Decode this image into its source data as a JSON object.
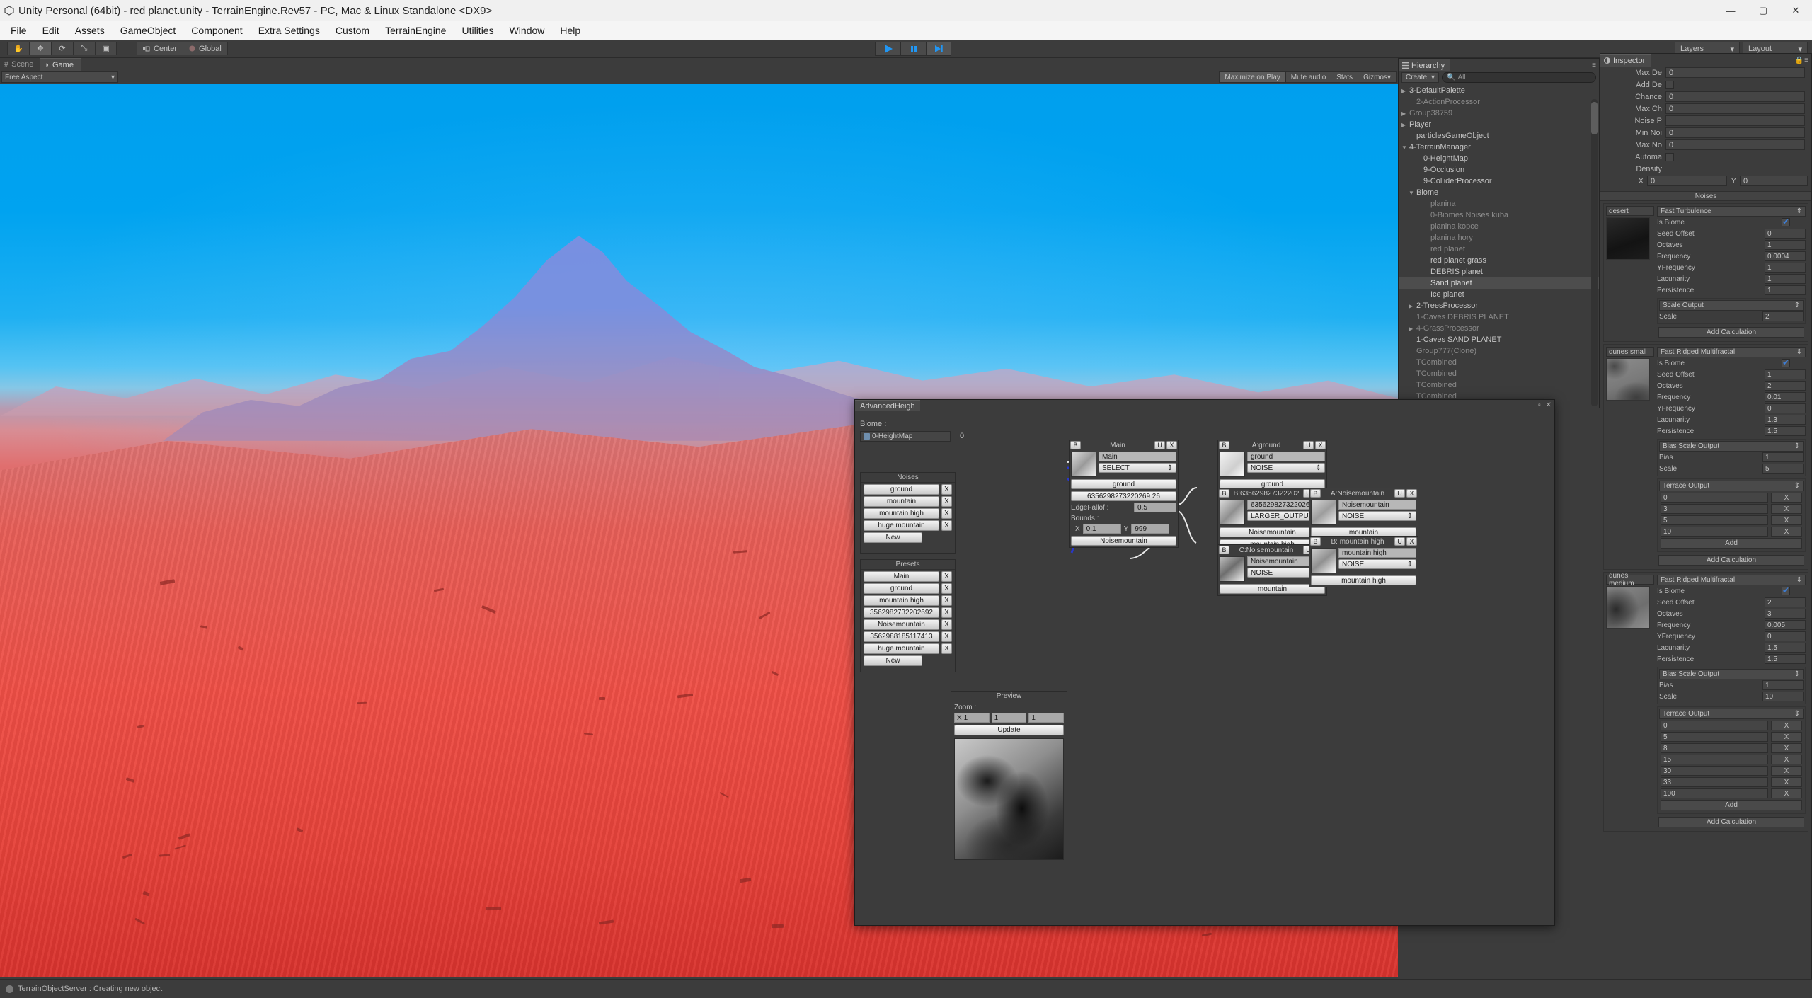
{
  "window": {
    "title": "Unity Personal (64bit) - red planet.unity - TerrainEngine.Rev57 - PC, Mac & Linux Standalone <DX9>",
    "app_icon": "unity-icon",
    "minimize": "—",
    "maximize": "▢",
    "close": "✕"
  },
  "menubar": {
    "items": [
      "File",
      "Edit",
      "Assets",
      "GameObject",
      "Component",
      "Extra Settings",
      "Custom",
      "TerrainEngine",
      "Utilities",
      "Window",
      "Help"
    ]
  },
  "toolbar": {
    "tools": [
      {
        "name": "hand-tool",
        "glyph": "✋",
        "active": false
      },
      {
        "name": "move-tool",
        "glyph": "✥",
        "active": true
      },
      {
        "name": "rotate-tool",
        "glyph": "⟳",
        "active": false
      },
      {
        "name": "scale-tool",
        "glyph": "⤡",
        "active": false
      },
      {
        "name": "rect-tool",
        "glyph": "▣",
        "active": false
      }
    ],
    "pivot": "Center",
    "handle": "Global",
    "play": "▶",
    "pause": "❙❙",
    "step": "▶❙",
    "layers": "Layers",
    "layout": "Layout"
  },
  "gameview": {
    "tabs": [
      {
        "label": "Scene",
        "icon": "scene-icon",
        "active": false
      },
      {
        "label": "Game",
        "icon": "game-icon",
        "active": true
      }
    ],
    "aspect": "Free Aspect",
    "buttons": [
      "Maximize on Play",
      "Mute audio",
      "Stats",
      "Gizmos"
    ]
  },
  "hierarchy": {
    "title": "Hierarchy",
    "create_label": "Create",
    "search_placeholder": "All",
    "search_value": "",
    "items": [
      {
        "label": "3-DefaultPalette",
        "indent": 0,
        "arrow": "▶",
        "dim": false,
        "selected": false
      },
      {
        "label": "2-ActionProcessor",
        "indent": 1,
        "arrow": "",
        "dim": true,
        "selected": false
      },
      {
        "label": "Group38759",
        "indent": 0,
        "arrow": "▶",
        "dim": true,
        "selected": false
      },
      {
        "label": "Player",
        "indent": 0,
        "arrow": "▶",
        "dim": false,
        "selected": false
      },
      {
        "label": "particlesGameObject",
        "indent": 1,
        "arrow": "",
        "dim": false,
        "selected": false
      },
      {
        "label": "4-TerrainManager",
        "indent": 0,
        "arrow": "▼",
        "dim": false,
        "selected": false
      },
      {
        "label": "0-HeightMap",
        "indent": 2,
        "arrow": "",
        "dim": false,
        "selected": false
      },
      {
        "label": "9-Occlusion",
        "indent": 2,
        "arrow": "",
        "dim": false,
        "selected": false
      },
      {
        "label": "9-ColliderProcessor",
        "indent": 2,
        "arrow": "",
        "dim": false,
        "selected": false
      },
      {
        "label": "Biome",
        "indent": 1,
        "arrow": "▼",
        "dim": false,
        "selected": false
      },
      {
        "label": "planina",
        "indent": 3,
        "arrow": "",
        "dim": true,
        "selected": false
      },
      {
        "label": "0-Biomes Noises kuba",
        "indent": 3,
        "arrow": "",
        "dim": true,
        "selected": false
      },
      {
        "label": "planina kopce",
        "indent": 3,
        "arrow": "",
        "dim": true,
        "selected": false
      },
      {
        "label": "planina hory",
        "indent": 3,
        "arrow": "",
        "dim": true,
        "selected": false
      },
      {
        "label": "red planet",
        "indent": 3,
        "arrow": "",
        "dim": true,
        "selected": false
      },
      {
        "label": "red planet grass",
        "indent": 3,
        "arrow": "",
        "dim": false,
        "selected": false
      },
      {
        "label": "DEBRIS planet",
        "indent": 3,
        "arrow": "",
        "dim": false,
        "selected": false
      },
      {
        "label": "Sand planet",
        "indent": 3,
        "arrow": "",
        "dim": true,
        "selected": true
      },
      {
        "label": "Ice planet",
        "indent": 3,
        "arrow": "",
        "dim": false,
        "selected": false
      },
      {
        "label": "2-TreesProcessor",
        "indent": 1,
        "arrow": "▶",
        "dim": false,
        "selected": false
      },
      {
        "label": "1-Caves DEBRIS PLANET",
        "indent": 1,
        "arrow": "",
        "dim": true,
        "selected": false
      },
      {
        "label": "4-GrassProcessor",
        "indent": 1,
        "arrow": "▶",
        "dim": true,
        "selected": false
      },
      {
        "label": "1-Caves SAND PLANET",
        "indent": 1,
        "arrow": "",
        "dim": false,
        "selected": false
      },
      {
        "label": "Group777(Clone)",
        "indent": 1,
        "arrow": "",
        "dim": true,
        "selected": false
      },
      {
        "label": "TCombined",
        "indent": 1,
        "arrow": "",
        "dim": true,
        "selected": false
      },
      {
        "label": "TCombined",
        "indent": 1,
        "arrow": "",
        "dim": true,
        "selected": false
      },
      {
        "label": "TCombined",
        "indent": 1,
        "arrow": "",
        "dim": true,
        "selected": false
      },
      {
        "label": "TCombined",
        "indent": 1,
        "arrow": "",
        "dim": true,
        "selected": false
      }
    ]
  },
  "inspector": {
    "title": "Inspector",
    "top_fields": [
      {
        "label": "Max De",
        "type": "text",
        "value": "0"
      },
      {
        "label": "Add De",
        "type": "check",
        "value": false
      },
      {
        "label": "Chance",
        "type": "text",
        "value": "0"
      },
      {
        "label": "Max Ch",
        "type": "text",
        "value": "0"
      },
      {
        "label": "Noise P",
        "type": "text",
        "value": ""
      },
      {
        "label": "Min Noi",
        "type": "text",
        "value": "0"
      },
      {
        "label": "Max No",
        "type": "text",
        "value": "0"
      },
      {
        "label": "Automa",
        "type": "check",
        "value": false
      }
    ],
    "density_label": "Density",
    "density_x_label": "X",
    "density_x": "0",
    "density_y_label": "Y",
    "density_y": "0",
    "noises_header": "Noises",
    "noises": [
      {
        "name": "desert",
        "type": "Fast Turbulence",
        "props": [
          {
            "label": "Is Biome",
            "value": "",
            "checked": true
          },
          {
            "label": "Seed Offset",
            "value": "0"
          },
          {
            "label": "Octaves",
            "value": "1"
          },
          {
            "label": "Frequency",
            "value": "0.0004"
          },
          {
            "label": "YFrequency",
            "value": "1"
          },
          {
            "label": "Lacunarity",
            "value": "1"
          },
          {
            "label": "Persistence",
            "value": "1"
          }
        ],
        "calcs": [
          {
            "type": "Scale Output",
            "rows": [
              {
                "label": "Scale",
                "value": "2"
              }
            ],
            "terrace": []
          }
        ],
        "add_calc": "Add Calculation"
      },
      {
        "name": "dunes small",
        "type": "Fast Ridged Multifractal",
        "props": [
          {
            "label": "Is Biome",
            "value": "",
            "checked": true
          },
          {
            "label": "Seed Offset",
            "value": "1"
          },
          {
            "label": "Octaves",
            "value": "2"
          },
          {
            "label": "Frequency",
            "value": "0.01"
          },
          {
            "label": "YFrequency",
            "value": "0"
          },
          {
            "label": "Lacunarity",
            "value": "1.3"
          },
          {
            "label": "Persistence",
            "value": "1.5"
          }
        ],
        "calcs": [
          {
            "type": "Bias Scale Output",
            "rows": [
              {
                "label": "Bias",
                "value": "1"
              },
              {
                "label": "Scale",
                "value": "5"
              }
            ],
            "terrace": []
          },
          {
            "type": "Terrace Output",
            "rows": [],
            "terrace": [
              "0",
              "3",
              "5",
              "10"
            ],
            "add_label": "Add"
          }
        ],
        "add_calc": "Add Calculation"
      },
      {
        "name": "dunes medium",
        "type": "Fast Ridged Multifractal",
        "props": [
          {
            "label": "Is Biome",
            "value": "",
            "checked": true
          },
          {
            "label": "Seed Offset",
            "value": "2"
          },
          {
            "label": "Octaves",
            "value": "3"
          },
          {
            "label": "Frequency",
            "value": "0.005"
          },
          {
            "label": "YFrequency",
            "value": "0"
          },
          {
            "label": "Lacunarity",
            "value": "1.5"
          },
          {
            "label": "Persistence",
            "value": "1.5"
          }
        ],
        "calcs": [
          {
            "type": "Bias Scale Output",
            "rows": [
              {
                "label": "Bias",
                "value": "1"
              },
              {
                "label": "Scale",
                "value": "10"
              }
            ],
            "terrace": []
          },
          {
            "type": "Terrace Output",
            "rows": [],
            "terrace": [
              "0",
              "5",
              "8",
              "15",
              "30",
              "33",
              "100"
            ],
            "add_label": "Add"
          }
        ],
        "add_calc": "Add Calculation"
      }
    ],
    "terrace_x": "X"
  },
  "advanced_window": {
    "tab_label": "AdvancedHeigh",
    "maximize": "▫",
    "close": "✕",
    "biome_label": "Biome :",
    "biome_object": "0-HeightMap",
    "biome_index": "0",
    "noises_panel": {
      "header": "Noises",
      "items": [
        "ground",
        "mountain",
        "mountain high",
        "huge mountain"
      ],
      "remove_label": "X",
      "new_label": "New"
    },
    "presets_panel": {
      "header": "Presets",
      "items": [
        "Main",
        "ground",
        "mountain high",
        "3562982732202692",
        "Noisemountain",
        "3562988185117413",
        "huge mountain"
      ],
      "remove_label": "X",
      "new_label": "New"
    },
    "preview": {
      "header": "Preview",
      "zoom_label": "Zoom :",
      "fields": [
        {
          "axis": "X",
          "value": "1"
        },
        {
          "axis": "",
          "value": "1"
        },
        {
          "axis": "",
          "value": "1"
        }
      ],
      "update_label": "Update"
    },
    "nodes": [
      {
        "id": "main",
        "title": "Main",
        "b": "B",
        "u": "U",
        "x": "X",
        "name_value": "Main",
        "mode": "SELECT",
        "buttons": [
          "ground",
          "6356298273220269 26"
        ],
        "edge_label": "EdgeFallof :",
        "edge_value": "0.5",
        "bounds_label": "Bounds :",
        "bounds_x_label": "X",
        "bounds_x": "0.1",
        "bounds_y_label": "Y",
        "bounds_y": "999",
        "extra_button": "Noisemountain"
      },
      {
        "id": "a-ground",
        "title": "A:ground",
        "b": "B",
        "u": "U",
        "x": "X",
        "name_value": "ground",
        "mode": "NOISE",
        "buttons": [
          "ground"
        ]
      },
      {
        "id": "b-635",
        "title": "B:635629827322202",
        "b": "B",
        "u": "U",
        "x": "X",
        "name_value": "635629827322026",
        "mode": "LARGER_OUTPUT",
        "buttons": [
          "Noisemountain",
          "mountain high"
        ]
      },
      {
        "id": "c-noisemountain",
        "title": "C:Noisemountain",
        "b": "B",
        "u": "U",
        "x": "X",
        "name_value": "Noisemountain",
        "mode": "NOISE",
        "buttons": [
          "mountain"
        ]
      },
      {
        "id": "a-noisemountain",
        "title": "A:Noisemountain",
        "b": "B",
        "u": "U",
        "x": "X",
        "name_value": "Noisemountain",
        "mode": "NOISE",
        "buttons": [
          "mountain"
        ]
      },
      {
        "id": "b-mountainhigh",
        "title": "B: mountain high",
        "b": "B",
        "u": "U",
        "x": "X",
        "name_value": "mountain high",
        "mode": "NOISE",
        "buttons": [
          "mountain high"
        ]
      }
    ]
  },
  "statusbar": {
    "icon": "info-icon",
    "text": "TerrainObjectServer : Creating new object"
  }
}
